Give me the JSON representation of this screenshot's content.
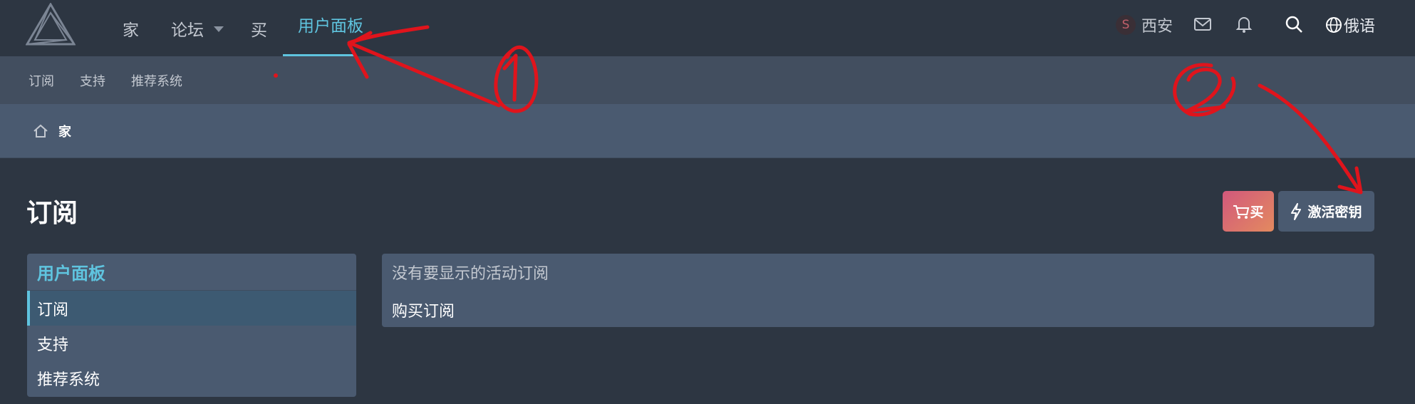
{
  "topnav": {
    "items": [
      {
        "label": "家"
      },
      {
        "label": "论坛"
      },
      {
        "label": "买"
      },
      {
        "label": "用户面板"
      }
    ],
    "user": {
      "initial": "S",
      "name": "西安"
    },
    "language": "俄语"
  },
  "subnav": {
    "items": [
      {
        "label": "订阅"
      },
      {
        "label": "支持"
      },
      {
        "label": "推荐系统"
      }
    ]
  },
  "breadcrumb": {
    "home_label": "家"
  },
  "page": {
    "title": "订阅",
    "buy_label": "买",
    "activate_label": "激活密钥"
  },
  "sidebar": {
    "heading": "用户面板",
    "items": [
      {
        "label": "订阅"
      },
      {
        "label": "支持"
      },
      {
        "label": "推荐系统"
      }
    ]
  },
  "main": {
    "empty_message": "没有要显示的活动订阅",
    "purchase_link": "购买订阅"
  },
  "colors": {
    "accent": "#5fc4df",
    "annotation": "#e0141c"
  }
}
